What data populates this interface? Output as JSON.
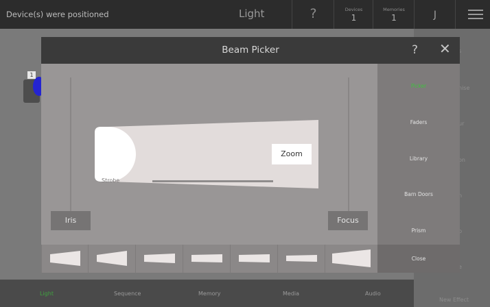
{
  "topbar": {
    "status": "Device(s) were positioned",
    "title": "Light",
    "help_icon": "?",
    "devices_label": "Devices",
    "devices_count": "1",
    "memories_label": "Memories",
    "memories_count": "1",
    "user_initial": "J"
  },
  "fixture": {
    "number": "1"
  },
  "background_side": {
    "items": [
      "s",
      "nise",
      "ur",
      "on",
      "n",
      "p",
      "e"
    ],
    "new_effect": "New Effect"
  },
  "bottom_tabs": [
    "Light",
    "Sequence",
    "Memory",
    "Media",
    "Audio"
  ],
  "modal": {
    "title": "Beam Picker",
    "help": "?",
    "close_icon": "✕",
    "strobe_label": "Strobe",
    "zoom_label": "Zoom",
    "iris_label": "Iris",
    "focus_label": "Focus",
    "menu": [
      "Picker",
      "Faders",
      "Library",
      "Barn Doors",
      "Prism"
    ],
    "close_label": "Close"
  },
  "colors": {
    "accent_green": "#3fc03f",
    "fixture_blue": "#2424d0"
  }
}
